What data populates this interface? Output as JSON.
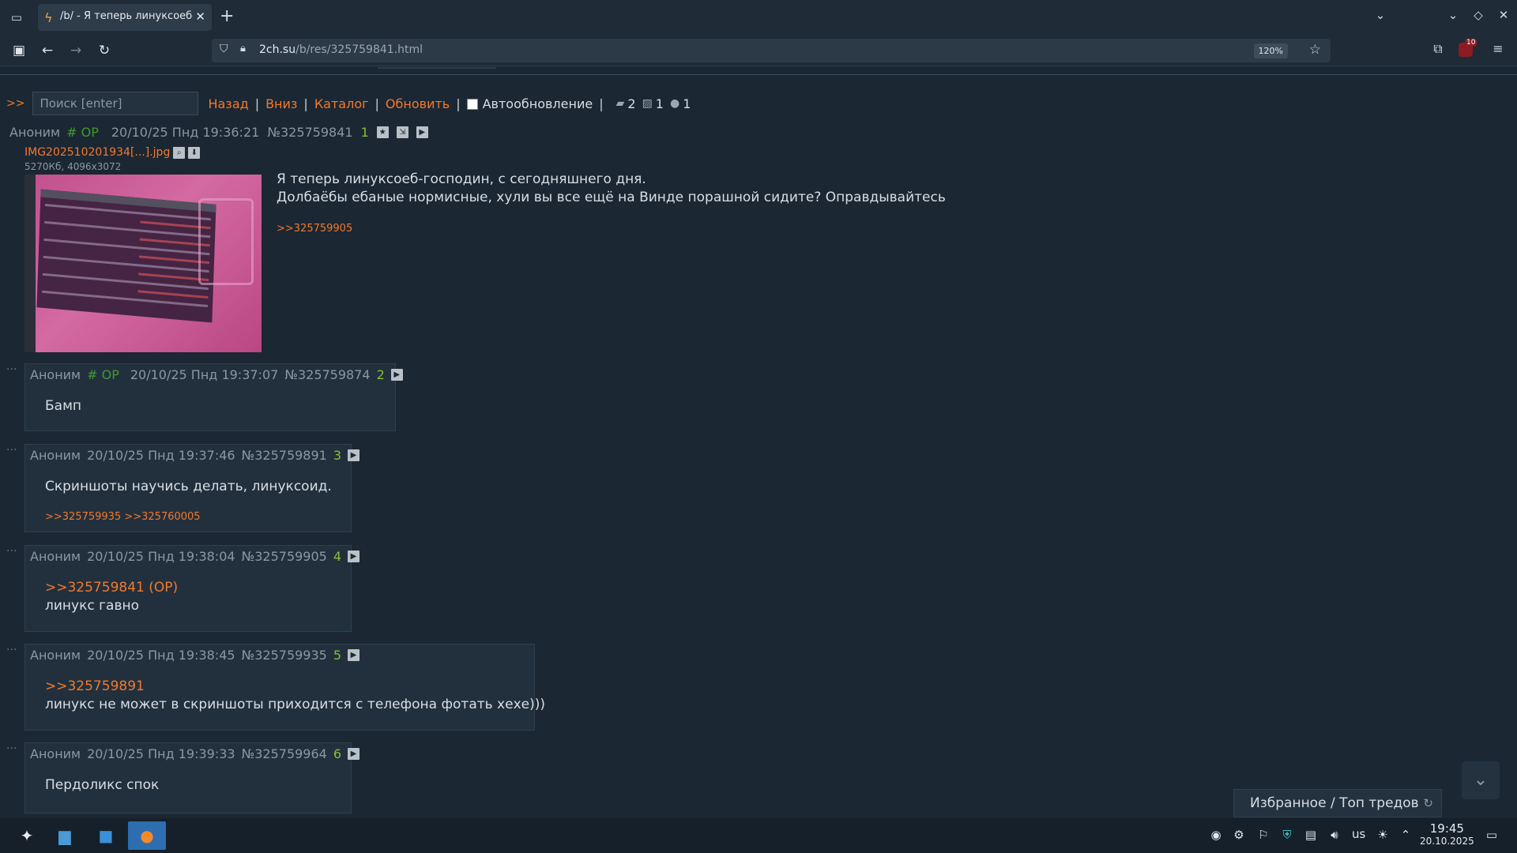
{
  "browser": {
    "tab_title": "/b/ - Я теперь линуксоеб-г",
    "url_host": "2ch.su",
    "url_path": "/b/res/325759841.html",
    "zoom": "120%",
    "ublock_count": "10"
  },
  "controls": {
    "prefix": ">>",
    "search_placeholder": "Поиск [enter]",
    "links": [
      "Назад",
      "Вниз",
      "Каталог",
      "Обновить"
    ],
    "autoupdate_label": "Автообновление",
    "stats": {
      "posts": "2",
      "images": "1",
      "posters": "1"
    }
  },
  "op": {
    "name": "Аноним",
    "trip": "# OP",
    "date": "20/10/25 Пнд 19:36:21",
    "number": "№325759841",
    "ordinal": "1",
    "file_name": "IMG202510201934[...].jpg",
    "file_meta": "5270Кб, 4096x3072",
    "text_lines": [
      "Я теперь линуксоеб-господин, с сегодняшнего дня.",
      "Долбаёбы ебаные нормисные, хули вы все ещё на Винде порашной сидите? Оправдывайтесь"
    ],
    "replies": ">>325759905"
  },
  "posts": [
    {
      "name": "Аноним",
      "trip": "# OP",
      "date": "20/10/25 Пнд 19:37:07",
      "number": "№325759874",
      "ordinal": "2",
      "link": "",
      "text": "Бамп",
      "replies": ""
    },
    {
      "name": "Аноним",
      "trip": "",
      "date": "20/10/25 Пнд 19:37:46",
      "number": "№325759891",
      "ordinal": "3",
      "link": "",
      "text": "Скриншоты научись делать, линуксоид.",
      "replies": ">>325759935 >>325760005"
    },
    {
      "name": "Аноним",
      "trip": "",
      "date": "20/10/25 Пнд 19:38:04",
      "number": "№325759905",
      "ordinal": "4",
      "link": ">>325759841 (OP)",
      "text": "линукс гавно",
      "replies": ""
    },
    {
      "name": "Аноним",
      "trip": "",
      "date": "20/10/25 Пнд 19:38:45",
      "number": "№325759935",
      "ordinal": "5",
      "link": ">>325759891",
      "text": "линукс не может в скриншоты приходится с телефона фотать хехе)))",
      "replies": ""
    },
    {
      "name": "Аноним",
      "trip": "",
      "date": "20/10/25 Пнд 19:39:33",
      "number": "№325759964",
      "ordinal": "6",
      "link": "",
      "text": "Пердоликс спок",
      "replies": ""
    }
  ],
  "favorites_label": "Избранное / Топ тредов",
  "taskbar": {
    "keyboard_layout": "us",
    "time": "19:45",
    "date": "20.10.2025"
  },
  "icons": {
    "tab_list": "tab-list-icon",
    "favicon": "lightning-icon",
    "back": "arrow-left-icon",
    "forward": "arrow-right-icon",
    "reload": "reload-icon",
    "extensions": "puzzle-icon",
    "menu": "hamburger-icon"
  },
  "colors": {
    "accent_link": "#f2792c",
    "trip_green": "#3e9a2e",
    "background": "#1b2733",
    "post_bg": "#22303d"
  }
}
